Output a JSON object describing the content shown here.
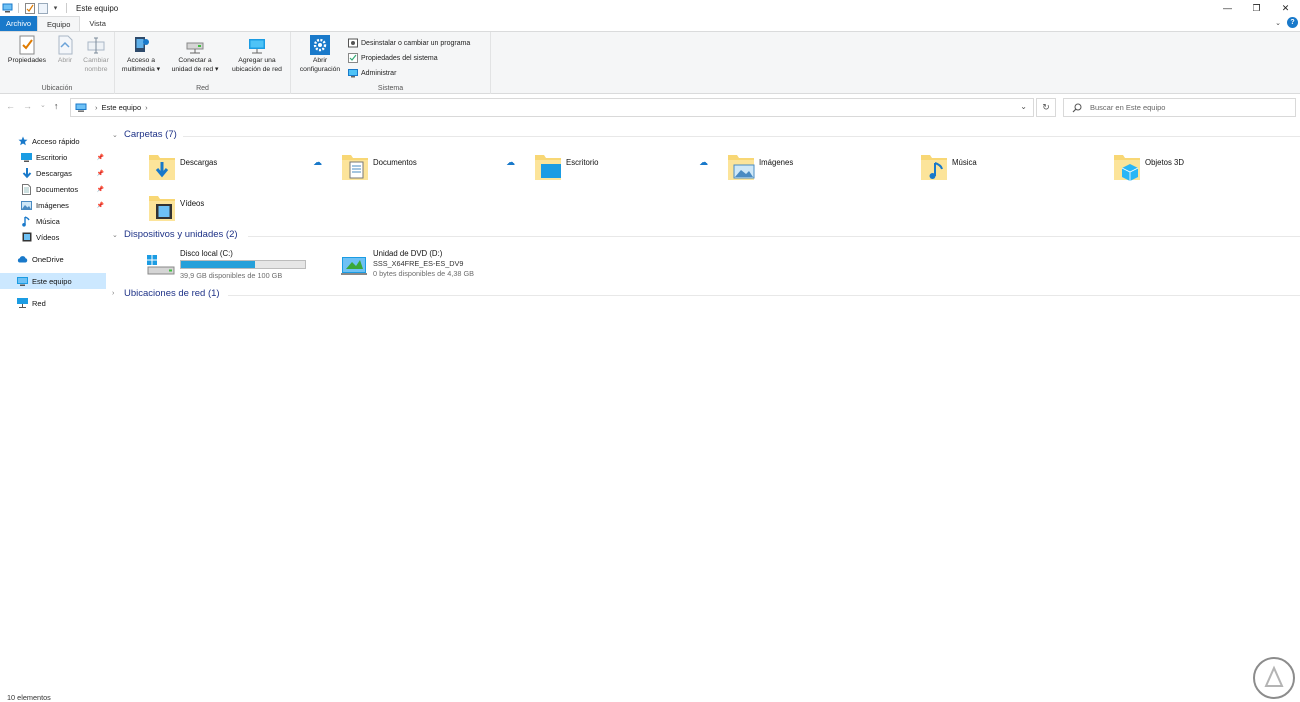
{
  "window": {
    "title": "Este equipo"
  },
  "tabs": {
    "file": "Archivo",
    "equipo": "Equipo",
    "vista": "Vista"
  },
  "ribbon": {
    "ubicacion": {
      "label": "Ubicación",
      "propiedades": "Propiedades",
      "abrir": "Abrir",
      "cambiar_line1": "Cambiar",
      "cambiar_line2": "nombre"
    },
    "red": {
      "label": "Red",
      "acceso_line1": "Acceso a",
      "acceso_line2": "multimedia ▾",
      "conectar_line1": "Conectar a",
      "conectar_line2": "unidad de red ▾",
      "agregar_line1": "Agregar una",
      "agregar_line2": "ubicación de red"
    },
    "sistema": {
      "label": "Sistema",
      "abrir_line1": "Abrir",
      "abrir_line2": "configuración",
      "desinstalar": "Desinstalar o cambiar un programa",
      "propiedades_sistema": "Propiedades del sistema",
      "administrar": "Administrar"
    }
  },
  "address": {
    "path": "Este equipo",
    "search_placeholder": "Buscar en Este equipo"
  },
  "sidebar": {
    "quick_access": "Acceso rápido",
    "items": [
      {
        "label": "Escritorio"
      },
      {
        "label": "Descargas"
      },
      {
        "label": "Documentos"
      },
      {
        "label": "Imágenes"
      },
      {
        "label": "Música"
      },
      {
        "label": "Vídeos"
      }
    ],
    "onedrive": "OneDrive",
    "this_pc": "Este equipo",
    "network": "Red"
  },
  "sections": {
    "folders": "Carpetas (7)",
    "devices": "Dispositivos y unidades (2)",
    "network": "Ubicaciones de red (1)"
  },
  "folders": [
    {
      "name": "Descargas"
    },
    {
      "name": "Documentos"
    },
    {
      "name": "Escritorio"
    },
    {
      "name": "Imágenes"
    },
    {
      "name": "Música"
    },
    {
      "name": "Objetos 3D"
    },
    {
      "name": "Vídeos"
    }
  ],
  "drives": {
    "c": {
      "name": "Disco local (C:)",
      "free": "39,9 GB disponibles de 100 GB",
      "used_fraction": 0.6
    },
    "d": {
      "name": "Unidad de DVD (D:)",
      "label": "SSS_X64FRE_ES-ES_DV9",
      "free": "0 bytes disponibles de 4,38 GB"
    }
  },
  "status": {
    "count": "10 elementos"
  },
  "colors": {
    "accent": "#1979ca",
    "folder": "#f8d775",
    "selection": "#cce8ff"
  }
}
